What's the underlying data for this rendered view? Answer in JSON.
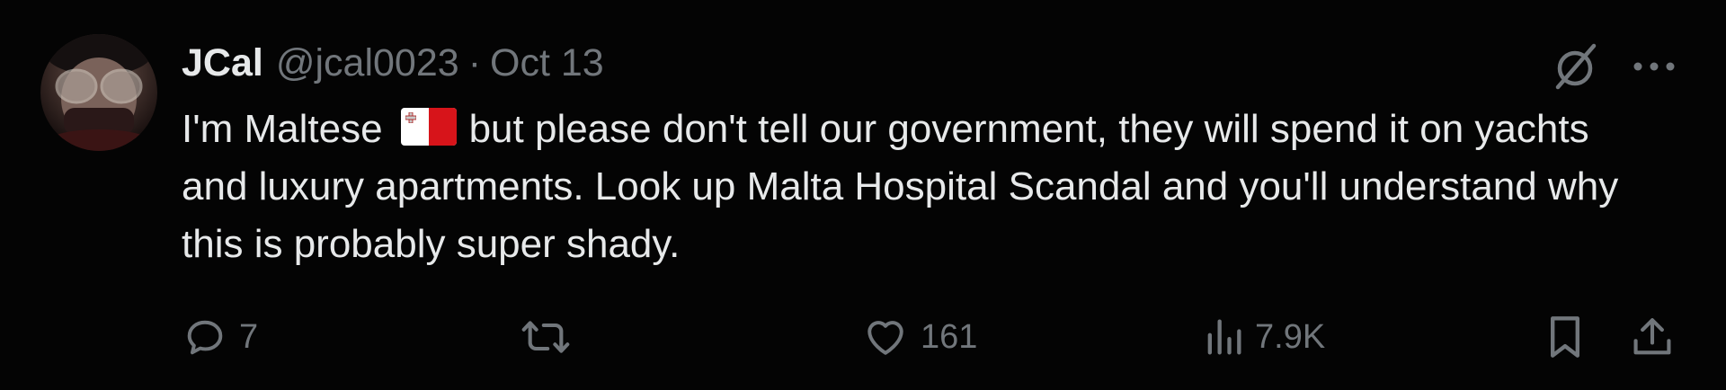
{
  "tweet": {
    "author": {
      "display_name": "JCal",
      "handle": "@jcal0023",
      "avatar_icon": "avatar"
    },
    "separator": "·",
    "date": "Oct 13",
    "text_before_flag": "I'm Maltese",
    "flag": {
      "icon": "malta-flag-icon",
      "colors": [
        "#ffffff",
        "#d7141a"
      ]
    },
    "text_after_flag": "but please don't tell our government, they will spend it on yachts and luxury apartments. Look up Malta Hospital Scandal and you'll understand why this is probably super shady.",
    "top_actions": {
      "grok_icon": "grok-icon",
      "more_icon": "more-options-icon"
    },
    "actions": {
      "reply": {
        "icon": "reply-icon",
        "count": "7"
      },
      "repost": {
        "icon": "repost-icon",
        "count": ""
      },
      "like": {
        "icon": "heart-icon",
        "count": "161"
      },
      "views": {
        "icon": "views-icon",
        "count": "7.9K"
      },
      "bookmark": {
        "icon": "bookmark-icon"
      },
      "share": {
        "icon": "share-icon"
      }
    }
  },
  "colors": {
    "background": "#000000",
    "text_primary": "#e7e9ea",
    "text_secondary": "#71767b"
  }
}
